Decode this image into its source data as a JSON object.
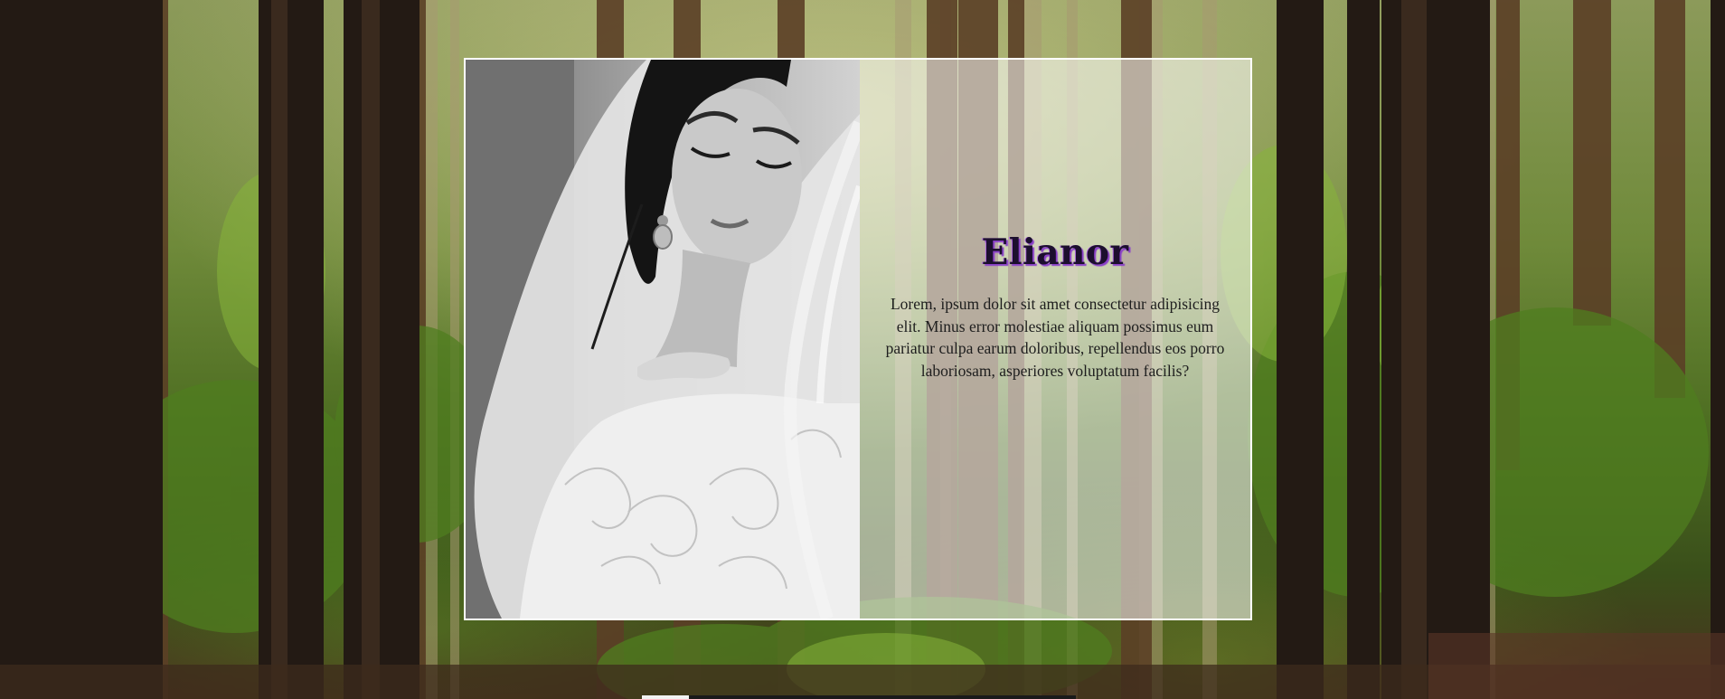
{
  "profile": {
    "name": "Elianor",
    "bio": "Lorem, ipsum dolor sit amet consectetur adipisicing elit. Minus error molestiae aliquam possimus eum pariatur culpa earum doloribus, repellendus eos porro laboriosam, asperiores voluptatum facilis?"
  },
  "colors": {
    "card_border": "#ffffff",
    "name_text": "#1c0f2e",
    "name_glow": "#8a3fc9"
  },
  "icons": {
    "portrait": "bride-photo-bw"
  }
}
